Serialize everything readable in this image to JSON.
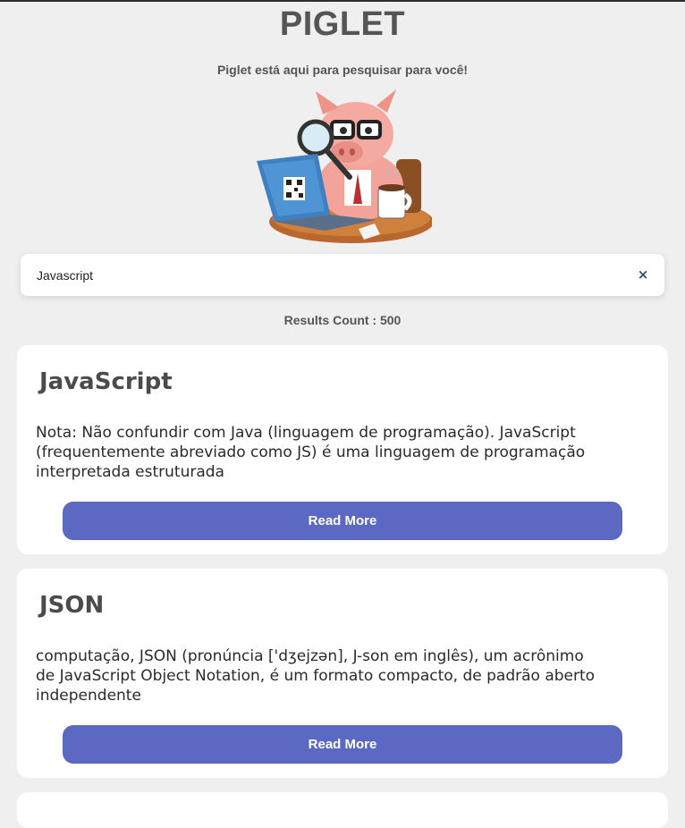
{
  "header": {
    "title": "PIGLET",
    "subtitle": "Piglet está aqui para pesquisar para você!"
  },
  "search": {
    "value": "Javascript",
    "clear_symbol": "×"
  },
  "results": {
    "label": "Results Count : 500"
  },
  "cards": [
    {
      "title": "JavaScript",
      "snippet": " Nota: Não confundir com Java (linguagem de programação). JavaScript (frequentemente abreviado como JS) é uma linguagem de programação interpretada estruturada",
      "button": "Read More"
    },
    {
      "title": "JSON",
      "snippet": "computação, JSON (pronúncia ['dʒejzən], J-son em inglês), um acrônimo de JavaScript Object Notation, é um formato compacto, de padrão aberto independente",
      "button": "Read More"
    }
  ],
  "colors": {
    "background": "#efefef",
    "card": "#ffffff",
    "button": "#5b69c2",
    "clear_icon": "#2f4d6d"
  }
}
